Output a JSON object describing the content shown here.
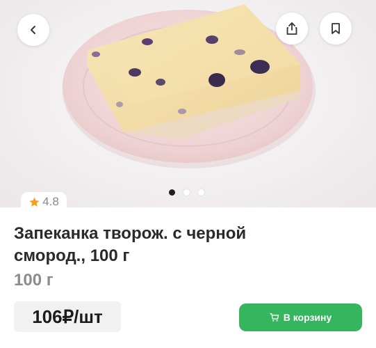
{
  "product": {
    "rating": "4.8",
    "title": "Запеканка творож. с черной смород., 100 г",
    "weight": "100 г",
    "price": "106₽/шт"
  },
  "actions": {
    "add_to_cart_label": "В корзину"
  },
  "carousel": {
    "total": 3,
    "active_index": 0
  },
  "icons": {
    "back": "chevron-left-icon",
    "share": "share-icon",
    "bookmark": "bookmark-icon",
    "star": "star-icon",
    "cart": "cart-icon"
  },
  "colors": {
    "accent": "#35b55e",
    "rating_star": "#f0a020"
  }
}
